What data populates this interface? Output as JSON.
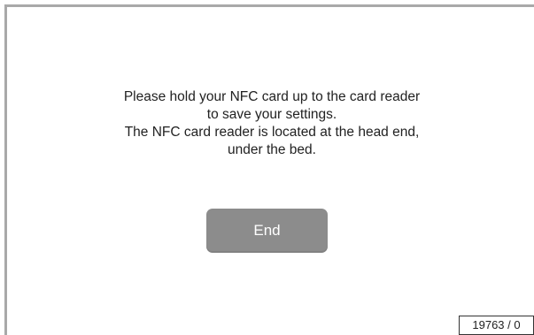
{
  "message": {
    "lines": [
      "Please hold your NFC card up to the card reader",
      "to save your settings.",
      "The NFC card reader is located at the head end,",
      "under the bed."
    ]
  },
  "actions": {
    "end_label": "End"
  },
  "footer": {
    "page_id": "19763 / 0"
  },
  "colors": {
    "frame": "#a9a9a9",
    "button_bg": "#8c8c8c",
    "button_text": "#ffffff",
    "text": "#222222",
    "background": "#ffffff"
  }
}
